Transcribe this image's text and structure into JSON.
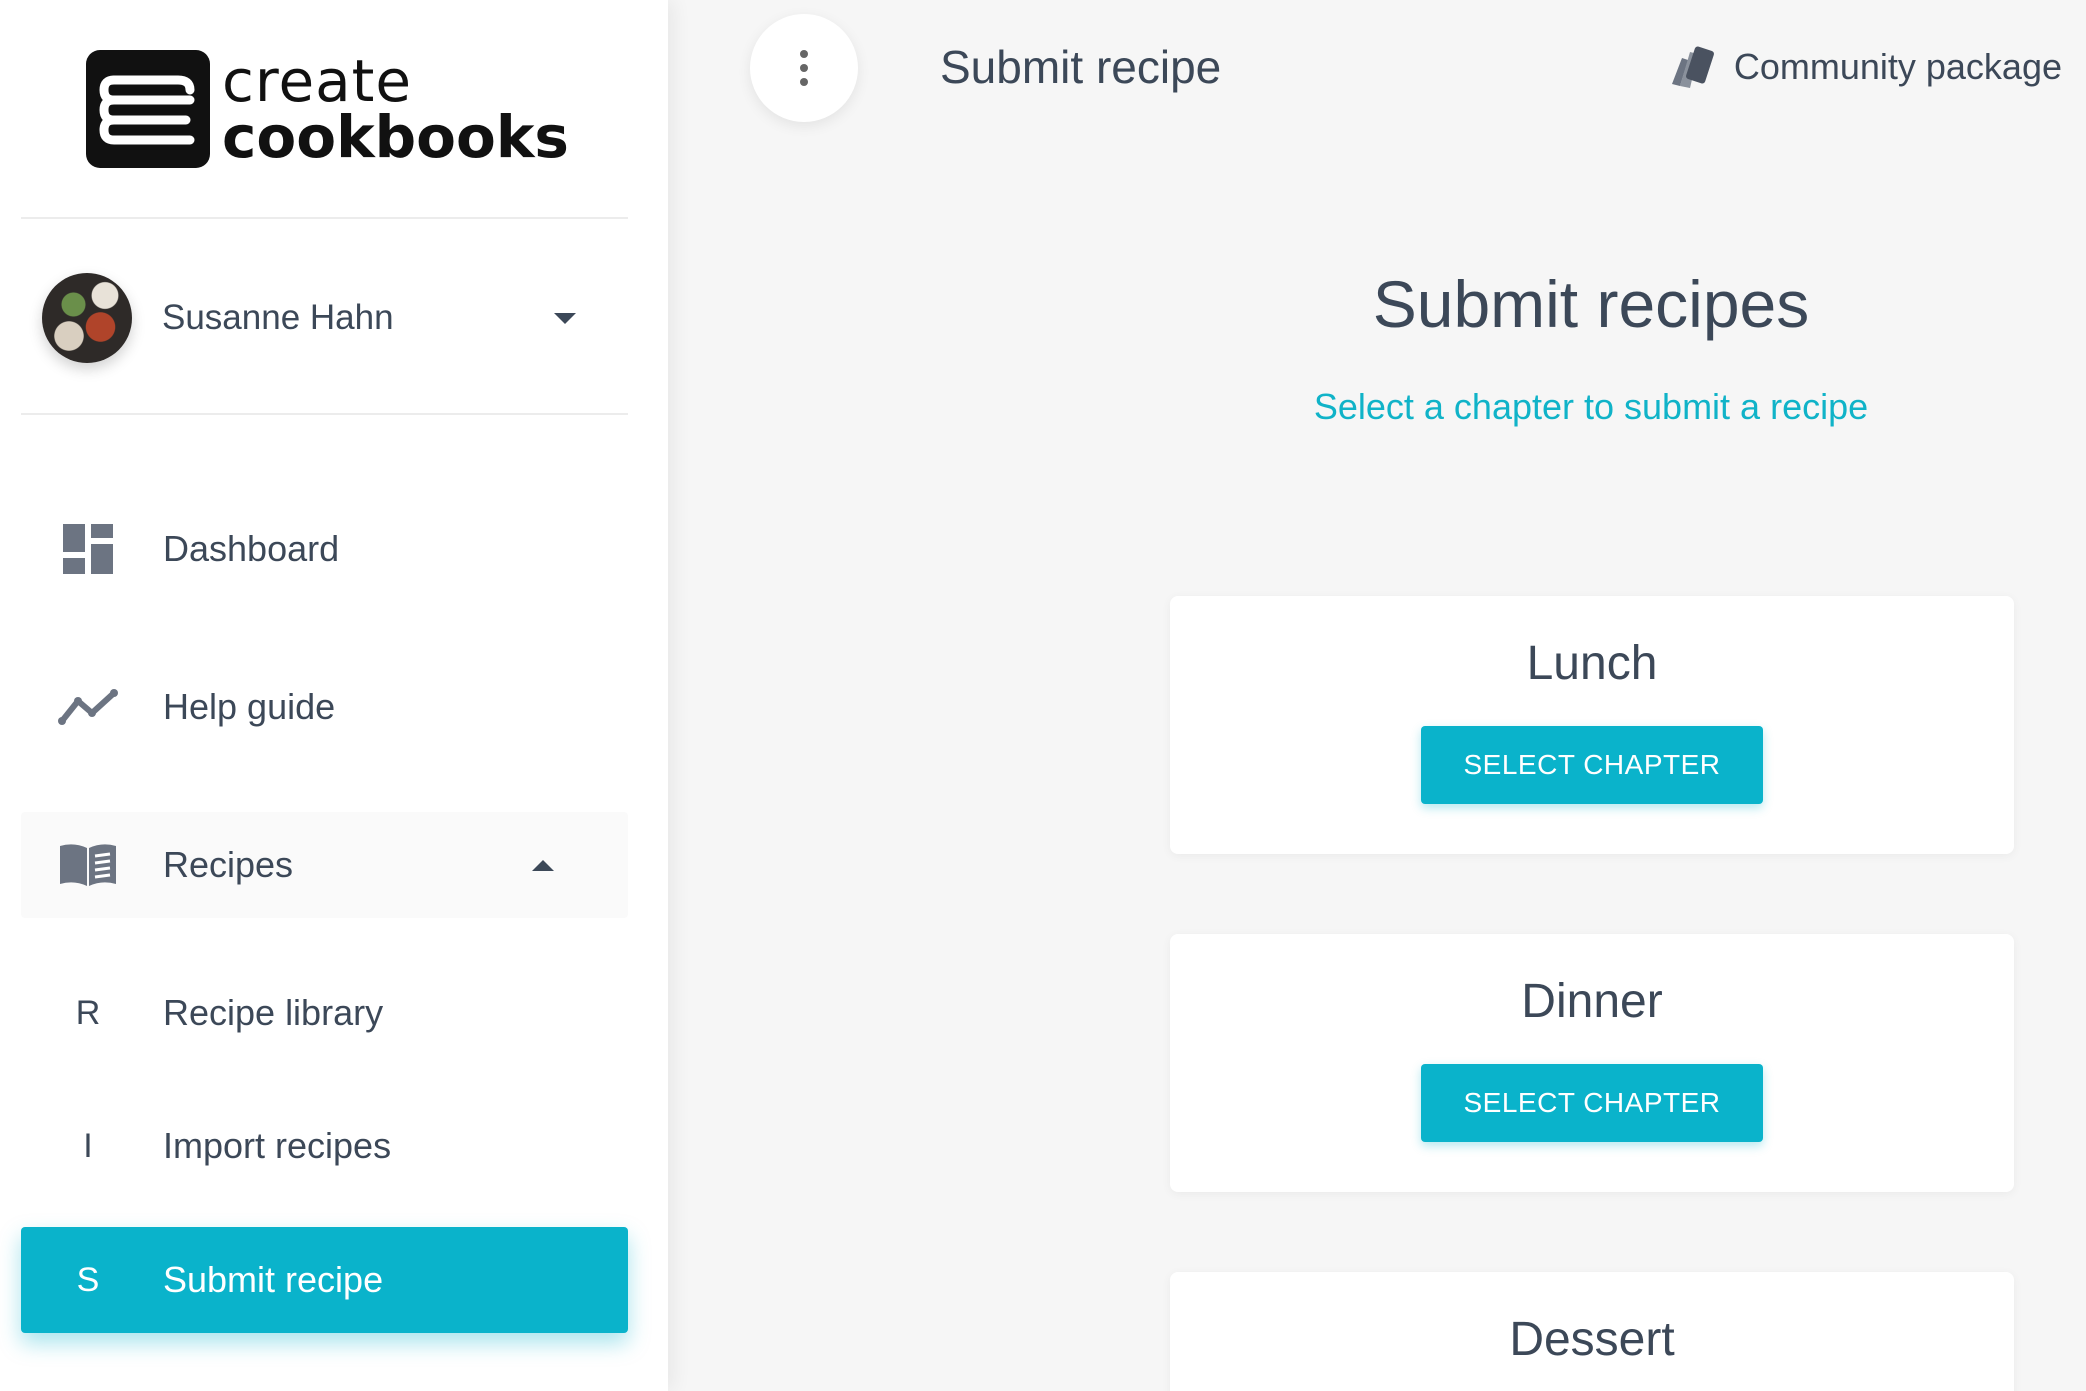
{
  "brand": {
    "line1": "create",
    "line2": "cookbooks"
  },
  "user": {
    "name": "Susanne Hahn"
  },
  "nav": {
    "items": [
      {
        "label": "Dashboard"
      },
      {
        "label": "Help guide"
      },
      {
        "label": "Recipes"
      }
    ],
    "sub_items": [
      {
        "letter": "R",
        "label": "Recipe library"
      },
      {
        "letter": "I",
        "label": "Import recipes"
      },
      {
        "letter": "S",
        "label": "Submit recipe"
      }
    ]
  },
  "header": {
    "title": "Submit recipe",
    "community_label": "Community package"
  },
  "main": {
    "heading": "Submit recipes",
    "subheading": "Select a chapter to submit a recipe",
    "chapters": [
      {
        "name": "Lunch",
        "button": "SELECT CHAPTER"
      },
      {
        "name": "Dinner",
        "button": "SELECT CHAPTER"
      },
      {
        "name": "Dessert"
      }
    ]
  },
  "colors": {
    "accent": "#0ab3cb",
    "text": "#3c4858",
    "background": "#f6f6f6"
  },
  "icons": [
    "logo-books-icon",
    "dashboard-icon",
    "trend-line-icon",
    "book-icon",
    "vertical-dots-icon",
    "swatch-icon",
    "caret-down-icon",
    "caret-up-icon"
  ]
}
